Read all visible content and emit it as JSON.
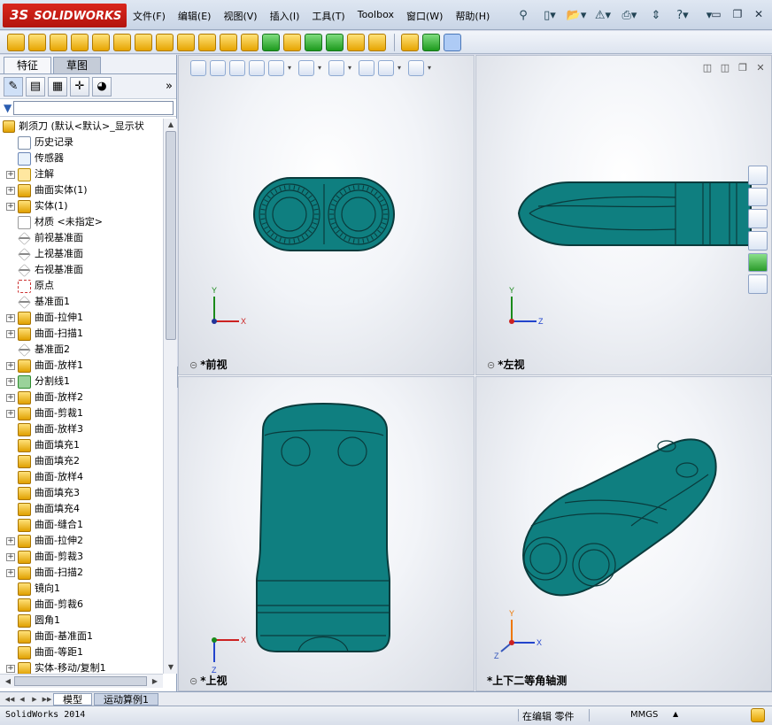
{
  "app": {
    "brand": "SOLIDWORKS",
    "brand_prefix": "3S"
  },
  "menu": [
    "文件(F)",
    "编辑(E)",
    "视图(V)",
    "插入(I)",
    "工具(T)",
    "Toolbox",
    "窗口(W)",
    "帮助(H)"
  ],
  "tabs": {
    "feature": "特征",
    "sketch": "草图"
  },
  "tree": {
    "root": "剃须刀 (默认<默认>_显示状",
    "items": [
      {
        "label": "历史记录",
        "icon": "history-icon",
        "expandable": false
      },
      {
        "label": "传感器",
        "icon": "sensor-icon",
        "expandable": false
      },
      {
        "label": "注解",
        "icon": "annotation-icon",
        "expandable": true
      },
      {
        "label": "曲面实体(1)",
        "icon": "surface-bodies-icon",
        "expandable": true
      },
      {
        "label": "实体(1)",
        "icon": "solid-bodies-icon",
        "expandable": true
      },
      {
        "label": "材质 <未指定>",
        "icon": "material-icon",
        "expandable": false
      },
      {
        "label": "前视基准面",
        "icon": "plane-icon",
        "expandable": false
      },
      {
        "label": "上视基准面",
        "icon": "plane-icon",
        "expandable": false
      },
      {
        "label": "右视基准面",
        "icon": "plane-icon",
        "expandable": false
      },
      {
        "label": "原点",
        "icon": "origin-icon",
        "expandable": false
      },
      {
        "label": "基准面1",
        "icon": "plane-icon",
        "expandable": false
      },
      {
        "label": "曲面-拉伸1",
        "icon": "surface-extrude-icon",
        "expandable": true
      },
      {
        "label": "曲面-扫描1",
        "icon": "surface-sweep-icon",
        "expandable": true
      },
      {
        "label": "基准面2",
        "icon": "plane-icon",
        "expandable": false
      },
      {
        "label": "曲面-放样1",
        "icon": "surface-loft-icon",
        "expandable": true
      },
      {
        "label": "分割线1",
        "icon": "split-line-icon",
        "expandable": true
      },
      {
        "label": "曲面-放样2",
        "icon": "surface-loft-icon",
        "expandable": true
      },
      {
        "label": "曲面-剪裁1",
        "icon": "surface-trim-icon",
        "expandable": true
      },
      {
        "label": "曲面-放样3",
        "icon": "surface-loft-icon",
        "expandable": false
      },
      {
        "label": "曲面填充1",
        "icon": "surface-fill-icon",
        "expandable": false
      },
      {
        "label": "曲面填充2",
        "icon": "surface-fill-icon",
        "expandable": false
      },
      {
        "label": "曲面-放样4",
        "icon": "surface-loft-icon",
        "expandable": false
      },
      {
        "label": "曲面填充3",
        "icon": "surface-fill-icon",
        "expandable": false
      },
      {
        "label": "曲面填充4",
        "icon": "surface-fill-icon",
        "expandable": false
      },
      {
        "label": "曲面-缝合1",
        "icon": "surface-knit-icon",
        "expandable": false
      },
      {
        "label": "曲面-拉伸2",
        "icon": "surface-extrude-icon",
        "expandable": true
      },
      {
        "label": "曲面-剪裁3",
        "icon": "surface-trim-icon",
        "expandable": true
      },
      {
        "label": "曲面-扫描2",
        "icon": "surface-sweep-icon",
        "expandable": true
      },
      {
        "label": "镜向1",
        "icon": "mirror-icon",
        "expandable": false
      },
      {
        "label": "曲面-剪裁6",
        "icon": "surface-trim-icon",
        "expandable": false
      },
      {
        "label": "圆角1",
        "icon": "fillet-icon",
        "expandable": false
      },
      {
        "label": "曲面-基准面1",
        "icon": "planar-surface-icon",
        "expandable": false
      },
      {
        "label": "曲面-等距1",
        "icon": "offset-surface-icon",
        "expandable": false
      },
      {
        "label": "实体-移动/复制1",
        "icon": "move-copy-icon",
        "expandable": true
      }
    ]
  },
  "viewports": {
    "front": "*前视",
    "left": "*左视",
    "top": "*上视",
    "iso": "*上下二等角轴测"
  },
  "axes": {
    "x": "X",
    "y": "Y",
    "z": "Z"
  },
  "bottom_tabs": [
    "模型",
    "运动算例1"
  ],
  "status": {
    "app": "SolidWorks 2014",
    "mode": "在编辑 零件",
    "units": "MMGS"
  },
  "colors": {
    "model_teal": "#0f7f80",
    "model_edge": "#0a3b3c",
    "brand_red": "#c41e15"
  }
}
